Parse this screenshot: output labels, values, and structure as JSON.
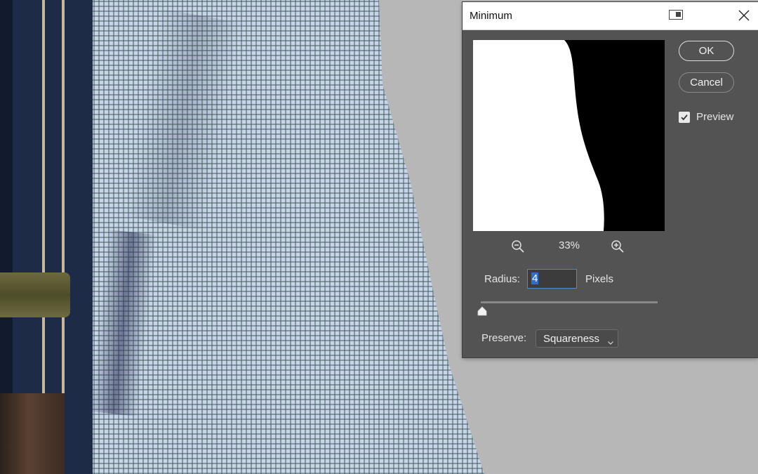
{
  "dialog": {
    "title": "Minimum",
    "ok_label": "OK",
    "cancel_label": "Cancel",
    "preview_label": "Preview",
    "preview_checked": true,
    "zoom_level": "33%",
    "radius_label": "Radius:",
    "radius_value": "4",
    "radius_unit": "Pixels",
    "preserve_label": "Preserve:",
    "preserve_value": "Squareness"
  },
  "icons": {
    "snap": "snap-layout-icon",
    "close": "close-icon",
    "zoom_out": "zoom-out-icon",
    "zoom_in": "zoom-in-icon",
    "check": "checkmark-icon",
    "dropdown": "chevron-down-icon",
    "slider": "slider-thumb-icon"
  },
  "colors": {
    "dialog_bg": "#535353",
    "canvas_bg": "#b7b7b7",
    "focus_blue": "#4a8ad6"
  }
}
